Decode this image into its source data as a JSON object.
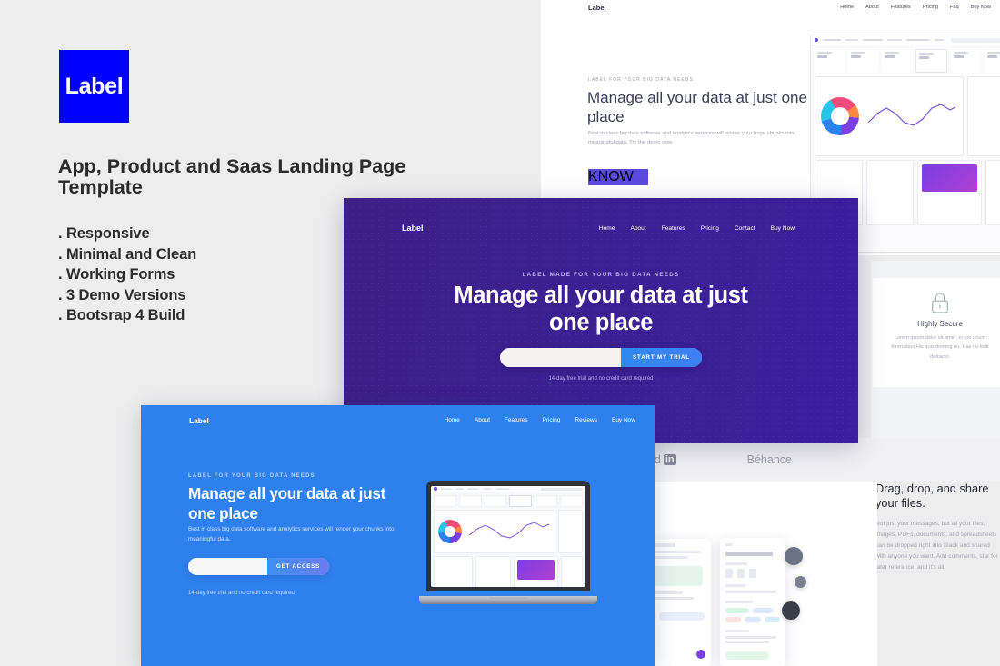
{
  "meta": {
    "background_color": "#ededed",
    "brand_blue": "#0000ff",
    "hero_purple": "#3b2094",
    "hero_blue": "#2f80ef",
    "accent_blue": "#2f8aee"
  },
  "left_panel": {
    "logo_text": "Label",
    "title": "App, Product and Saas Landing Page Template",
    "features": [
      ". Responsive",
      ". Minimal and Clean",
      ". Working Forms",
      ". 3 Demo Versions",
      ". Bootsrap 4 Build"
    ]
  },
  "white_page": {
    "logo_text": "Label",
    "nav": [
      "Home",
      "About",
      "Features",
      "Pricing",
      "Faq",
      "Buy Now"
    ],
    "eyebrow": "LABEL FOR YOUR BIG DATA NEEDS",
    "headline": "Manage all your data at just one place",
    "subcopy": "Best in class big data software and analytics services will render your huge chunks into meaningful data. Try the demo now.",
    "cta_label": "KNOW MORE"
  },
  "logos_band": {
    "brands": [
      {
        "name": "Linked",
        "badge": "in"
      },
      {
        "name": "Béhance",
        "badge": ""
      }
    ]
  },
  "secure_section": {
    "icon": "lock-icon",
    "title": "Highly Secure",
    "copy": "Lorem ipsum dolor sit amet, ei pro unum forensibus His quis doming eu. Has no tollit detracto."
  },
  "drag_drop_section": {
    "title": "Drag, drop, and share your files.",
    "copy": "Not just your messages, but all your files, images, PDFs, documents, and spreadsheets can be dropped right into Slack and shared with anyone you want. Add comments, star for later reference, and it's all."
  },
  "purple_hero": {
    "logo_text": "Label",
    "nav": [
      "Home",
      "About",
      "Features",
      "Pricing",
      "Contact",
      "Buy Now"
    ],
    "eyebrow": "LABEL MADE FOR YOUR BIG DATA NEEDS",
    "headline": "Manage all your data at just one place",
    "email_placeholder": "",
    "email_value": "",
    "cta_label": "START MY TRIAL",
    "note": "14-day free trial and no credit card required"
  },
  "blue_hero": {
    "logo_text": "Label",
    "nav": [
      "Home",
      "About",
      "Features",
      "Pricing",
      "Reviews",
      "Buy Now"
    ],
    "eyebrow": "LABEL FOR YOUR BIG DATA NEEDS",
    "headline": "Manage all your data at just one place",
    "copy": "Best in class big data software and analytics services will render your chunks into meaningful data.",
    "email_placeholder": "",
    "email_value": "",
    "cta_label": "GET ACCESS",
    "note": "14-day free trial and no credit card required"
  }
}
